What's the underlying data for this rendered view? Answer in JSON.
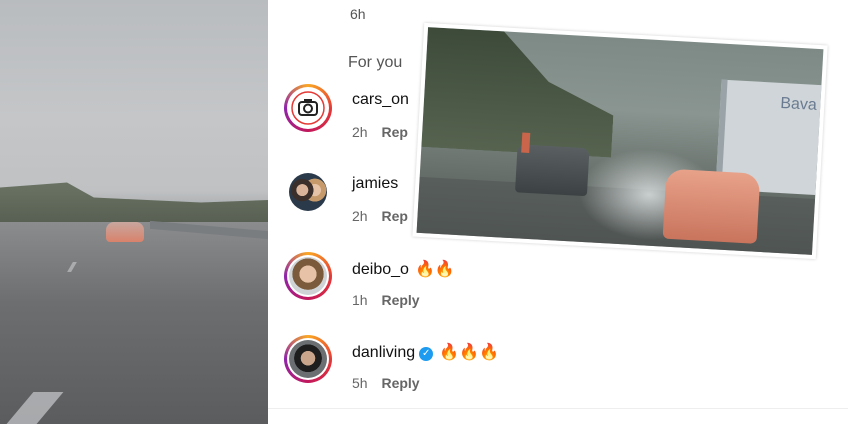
{
  "comments_header": {
    "top_time": "6h",
    "section_label": "For you"
  },
  "comments": [
    {
      "username": "cars_on",
      "text": "",
      "time": "2h",
      "reply": "Rep",
      "verified": false
    },
    {
      "username": "jamies",
      "text": "",
      "time": "2h",
      "reply": "Rep",
      "verified": false
    },
    {
      "username": "deibo_o",
      "text": "🔥🔥",
      "time": "1h",
      "reply": "Reply",
      "verified": false
    },
    {
      "username": "danliving",
      "text": "🔥🔥🔥",
      "time": "5h",
      "reply": "Reply",
      "verified": true
    }
  ],
  "overlay": {
    "truck_text": "Bava"
  },
  "colors": {
    "story_ring": "#e53935",
    "verified": "#1d9bf0"
  }
}
